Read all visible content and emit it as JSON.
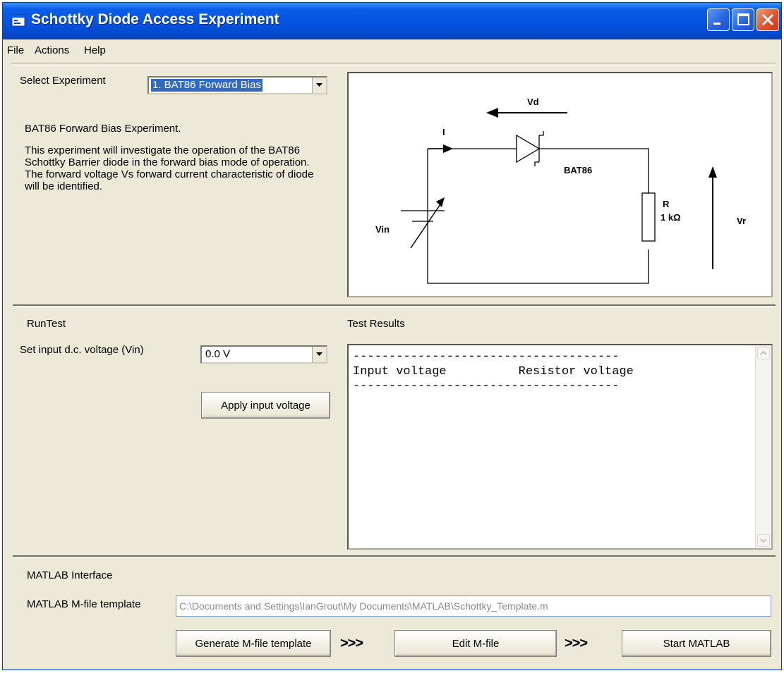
{
  "window": {
    "title": "Schottky Diode Access Experiment"
  },
  "menu": [
    "File",
    "Actions",
    "Help"
  ],
  "experiment": {
    "label": "Select Experiment",
    "selected": "1. BAT86 Forward Bias",
    "title": "BAT86 Forward Bias Experiment.",
    "description": "This experiment will investigate the operation of the BAT86 Schottky Barrier diode in the forward bias mode of operation. The forward voltage Vs forward current characteristic of diode will be identified."
  },
  "circuit": {
    "vd": "Vd",
    "i": "I",
    "diode": "BAT86",
    "r_name": "R",
    "r_value": "1 kΩ",
    "vin": "Vin",
    "vr": "Vr"
  },
  "run_test": {
    "section_label": "RunTest",
    "vin_label": "Set input d.c. voltage (Vin)",
    "vin_value": "0.0 V",
    "apply_button": "Apply input voltage"
  },
  "results": {
    "label": "Test Results",
    "text": "-------------------------------------\nInput voltage          Resistor voltage\n-------------------------------------"
  },
  "matlab": {
    "section_label": "MATLAB Interface",
    "template_label": "MATLAB M-file template",
    "template_path": "C:\\Documents and Settings\\IanGrout\\My Documents\\MATLAB\\Schottky_Template.m",
    "generate_button": "Generate M-file template",
    "edit_button": "Edit M-file",
    "start_button": "Start MATLAB",
    "arrows": ">>>"
  }
}
